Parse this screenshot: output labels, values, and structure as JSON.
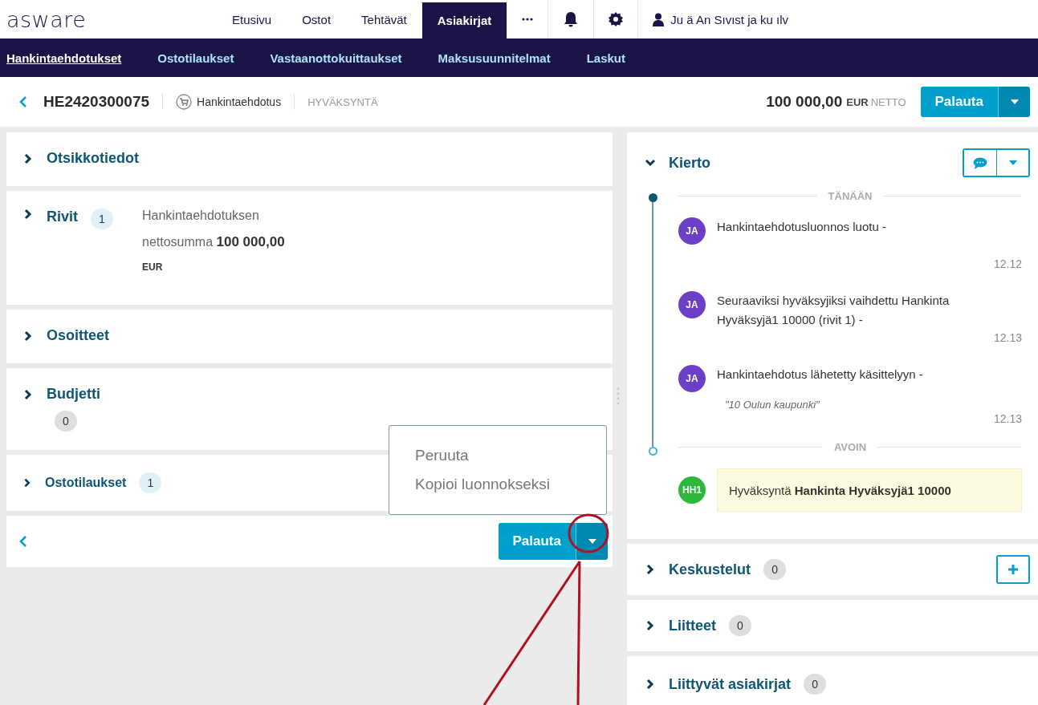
{
  "logo": "asware",
  "top_nav": [
    {
      "label": "Etusivu",
      "selected": false
    },
    {
      "label": "Ostot",
      "selected": false
    },
    {
      "label": "Tehtävät",
      "selected": false
    },
    {
      "label": "Asiakirjat",
      "selected": true
    }
  ],
  "user_name": "Ju ä An Sıvıst ja ku ılv",
  "sub_nav": [
    {
      "label": "Hankintaehdotukset",
      "selected": true
    },
    {
      "label": "Ostotilaukset",
      "selected": false
    },
    {
      "label": "Vastaanottokuittaukset",
      "selected": false
    },
    {
      "label": "Maksusuunnitelmat",
      "selected": false
    },
    {
      "label": "Laskut",
      "selected": false
    }
  ],
  "document": {
    "id": "HE2420300075",
    "type": "Hankintaehdotus",
    "status": "HYVÄKSYNTÄ",
    "amount": "100 000,00",
    "currency": "EUR",
    "net": "NETTO",
    "action": "Palauta"
  },
  "left_sections": [
    {
      "kind": "plain",
      "title": "Otsikkotiedot"
    },
    {
      "kind": "summary",
      "title": "Rivit",
      "count": "1",
      "color": "#e1f1fa",
      "summary": "Hankintaehdotuksen",
      "summary_label": "nettosumma",
      "summary_amount": "100 000,00",
      "currency": "EUR"
    },
    {
      "kind": "plain",
      "title": "Osoitteet"
    },
    {
      "kind": "count_below",
      "title": "Budjetti",
      "count": "0",
      "color": "#dedede"
    },
    {
      "kind": "small",
      "title": "Ostotilaukset",
      "count": "1",
      "color": "#e1f1fa"
    }
  ],
  "menu": {
    "items": [
      "Peruuta",
      "Kopioi luonnokseksi"
    ]
  },
  "footer_action": "Palauta",
  "workflow": {
    "title": "Kierto",
    "expanded": true,
    "groups": [
      {
        "label": "TÄNÄÄN",
        "completed": true,
        "events": [
          {
            "avatar": "JA",
            "color": "#6b3fc6",
            "text": "Hankintaehdotusluonnos luotu -",
            "time": "12.12"
          },
          {
            "avatar": "JA",
            "color": "#6b3fc6",
            "text": "Seuraaviksi hyväksyjiksi vaihdettu Hankinta Hyväksyjä1 10000 (rivit 1) -",
            "time": "12.13"
          },
          {
            "avatar": "JA",
            "color": "#6b3fc6",
            "text": "Hankintaehdotus lähetetty käsittelyyn -",
            "note": "\"10 Oulun kaupunki\"",
            "time": "12.13"
          }
        ]
      },
      {
        "label": "AVOIN",
        "completed": false,
        "pending": [
          {
            "avatar": "HH1",
            "color": "#2db83d",
            "text": "Hyväksyntä **Hankinta Hyväksyjä1 10000**"
          }
        ]
      }
    ]
  },
  "right_sections": [
    {
      "title": "Keskustelut",
      "count": "0",
      "add": true
    },
    {
      "title": "Liitteet",
      "count": "0",
      "add": false
    },
    {
      "title": "Liittyvät asiakirjat",
      "count": "0",
      "add": false
    }
  ]
}
